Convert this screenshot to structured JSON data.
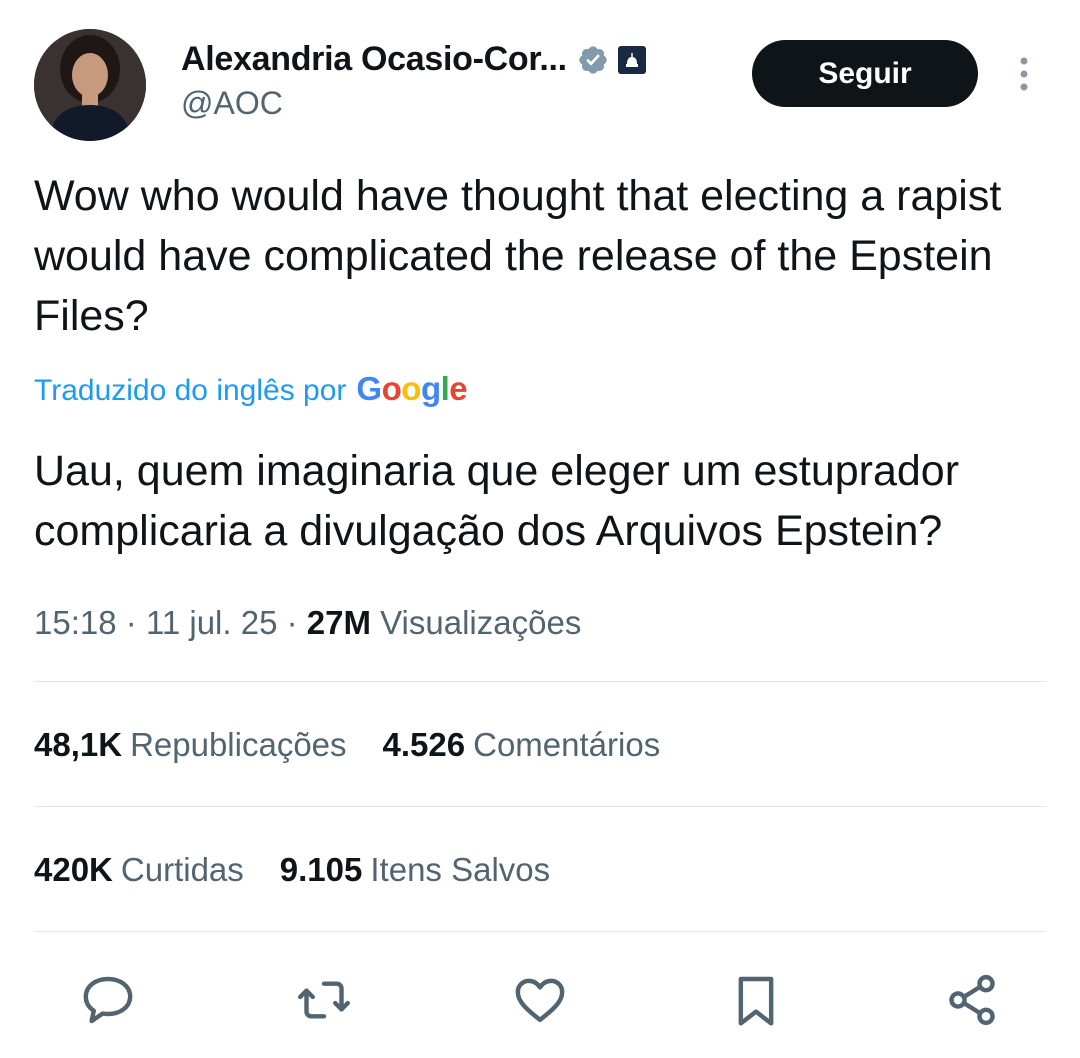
{
  "author": {
    "name": "Alexandria Ocasio-Cor...",
    "handle": "@AOC",
    "avatar": "avatar-photo",
    "verified_icon": "verified-badge-icon",
    "affiliation_icon": "government-capitol-badge-icon"
  },
  "follow_button": {
    "label": "Seguir"
  },
  "more_menu": {
    "icon": "more-vertical-icon"
  },
  "tweet": {
    "text": "Wow who would have thought that electing a rapist would have complicated the release of the Epstein Files?",
    "translation_credit": "Traduzido do inglês por",
    "translation_provider": "Google",
    "translated_text": "Uau, quem imaginaria que eleger um estuprador complicaria a divulgação dos Arquivos Epstein?"
  },
  "meta": {
    "time": "15:18",
    "separator": "·",
    "date": "11 jul. 25",
    "views_count": "27M",
    "views_label": "Visualizações"
  },
  "stats": [
    {
      "count": "48,1K",
      "label": "Republicações"
    },
    {
      "count": "4.526",
      "label": "Comentários"
    },
    {
      "count": "420K",
      "label": "Curtidas"
    },
    {
      "count": "9.105",
      "label": "Itens Salvos"
    }
  ],
  "actions": [
    "reply-icon",
    "repost-icon",
    "like-icon",
    "bookmark-icon",
    "share-icon"
  ],
  "colors": {
    "text": "#0f1419",
    "secondary": "#536471",
    "link": "#1d9bf0",
    "button_bg": "#0f1419",
    "divider": "#e1e8ed"
  }
}
